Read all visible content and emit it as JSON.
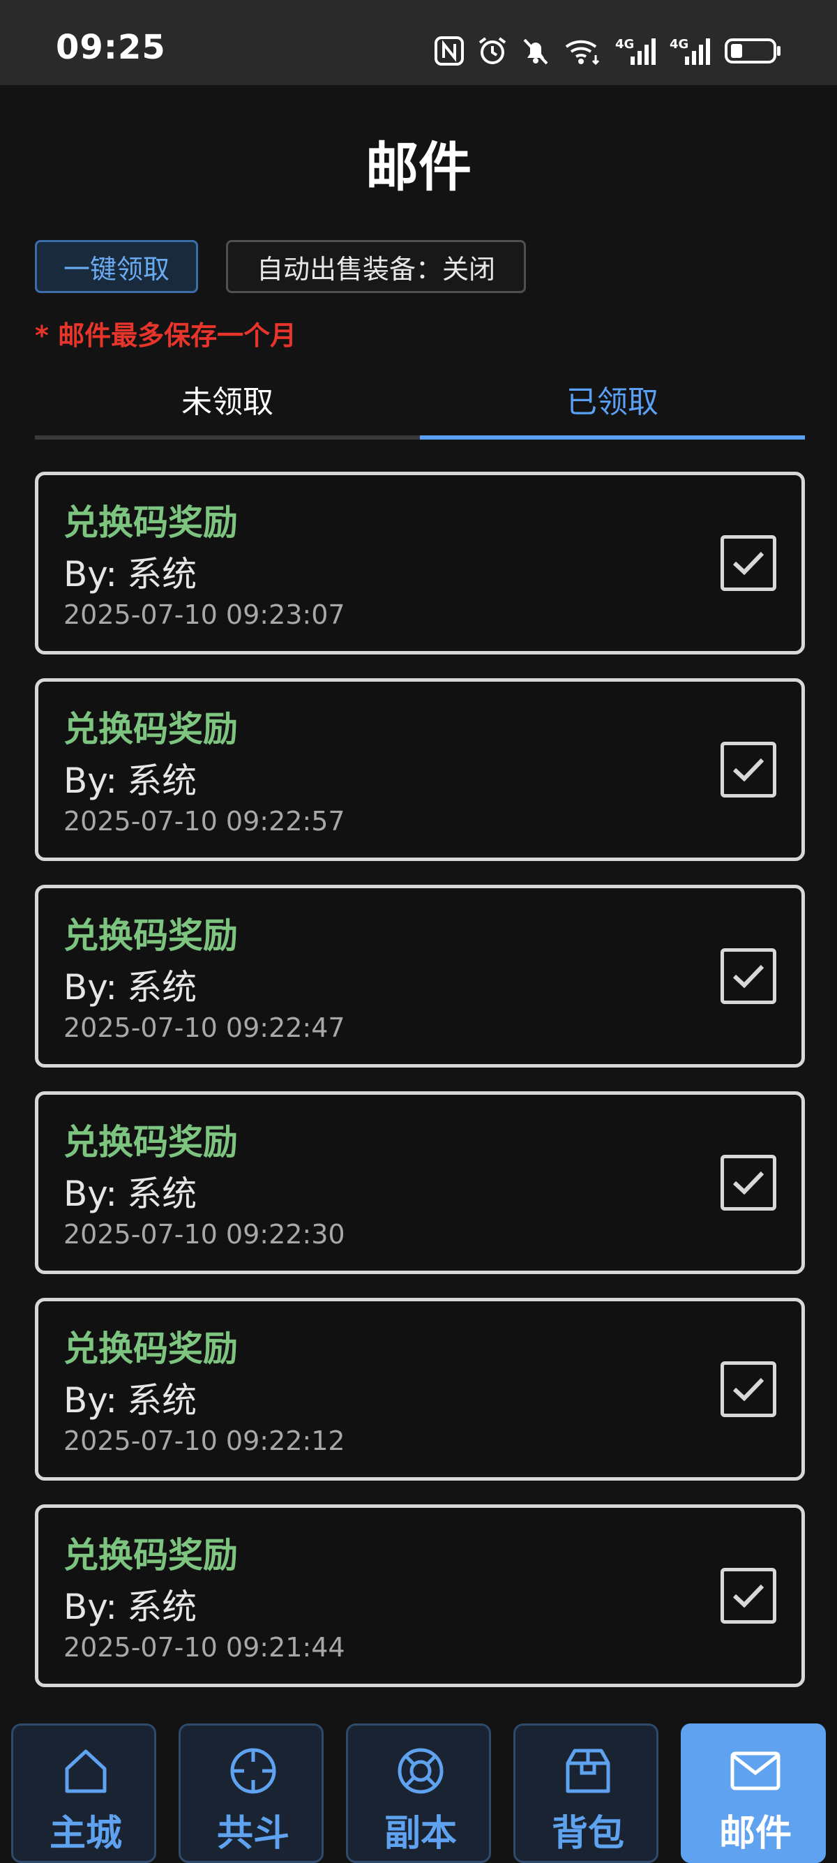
{
  "status_bar": {
    "time": "09:25",
    "icons": [
      "nfc-icon",
      "alarm-icon",
      "mute-icon",
      "wifi-icon",
      "signal-4g-icon",
      "signal-4g-icon",
      "battery-icon"
    ],
    "network_1": "4G",
    "network_2": "4G"
  },
  "header": {
    "title": "邮件"
  },
  "actions": {
    "claim_all": "一键领取",
    "auto_sell": "自动出售装备：关闭"
  },
  "notice": "* 邮件最多保存一个月",
  "tabs": [
    {
      "label": "未领取",
      "active": false
    },
    {
      "label": "已领取",
      "active": true
    }
  ],
  "mails": [
    {
      "title": "兑换码奖励",
      "from_prefix": "By:",
      "from": "系统",
      "time": "2025-07-10 09:23:07",
      "checked": true
    },
    {
      "title": "兑换码奖励",
      "from_prefix": "By:",
      "from": "系统",
      "time": "2025-07-10 09:22:57",
      "checked": true
    },
    {
      "title": "兑换码奖励",
      "from_prefix": "By:",
      "from": "系统",
      "time": "2025-07-10 09:22:47",
      "checked": true
    },
    {
      "title": "兑换码奖励",
      "from_prefix": "By:",
      "from": "系统",
      "time": "2025-07-10 09:22:30",
      "checked": true
    },
    {
      "title": "兑换码奖励",
      "from_prefix": "By:",
      "from": "系统",
      "time": "2025-07-10 09:22:12",
      "checked": true
    },
    {
      "title": "兑换码奖励",
      "from_prefix": "By:",
      "from": "系统",
      "time": "2025-07-10 09:21:44",
      "checked": true
    }
  ],
  "bottom_nav": [
    {
      "label": "主城",
      "icon": "home-icon",
      "active": false
    },
    {
      "label": "共斗",
      "icon": "crosshair-icon",
      "active": false
    },
    {
      "label": "副本",
      "icon": "lifebuoy-icon",
      "active": false
    },
    {
      "label": "背包",
      "icon": "package-icon",
      "active": false
    },
    {
      "label": "邮件",
      "icon": "mail-icon",
      "active": true
    }
  ],
  "colors": {
    "accent_blue": "#5ea2f0",
    "mail_title_green": "#7cc47f",
    "notice_red": "#e8352b",
    "background": "#131313",
    "status_bar": "#2a2a2a"
  }
}
